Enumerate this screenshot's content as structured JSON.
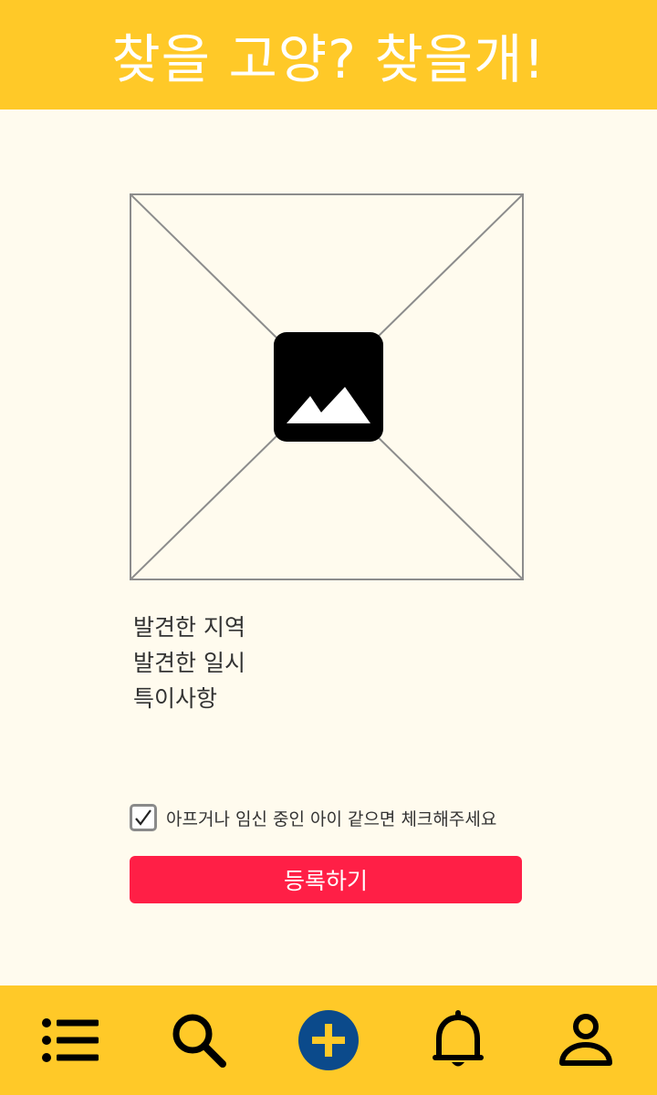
{
  "header": {
    "title": "찾을 고양? 찾을개!"
  },
  "photo": {
    "icon": "image-placeholder-icon"
  },
  "form": {
    "fields": [
      {
        "label": "발견한 지역"
      },
      {
        "label": "발견한 일시"
      },
      {
        "label": "특이사항"
      }
    ],
    "checkbox": {
      "label": "아프거나 임신 중인 아이 같으면 체크해주세요",
      "checked": true
    },
    "submit_label": "등록하기"
  },
  "tabbar": {
    "items": [
      {
        "icon": "list-icon"
      },
      {
        "icon": "search-icon"
      },
      {
        "icon": "add-icon"
      },
      {
        "icon": "bell-icon"
      },
      {
        "icon": "user-icon"
      }
    ]
  },
  "colors": {
    "primary_yellow": "#FFC928",
    "background": "#FFFBEE",
    "submit_red": "#FF1F46",
    "add_button_blue": "#0B4A8B"
  }
}
